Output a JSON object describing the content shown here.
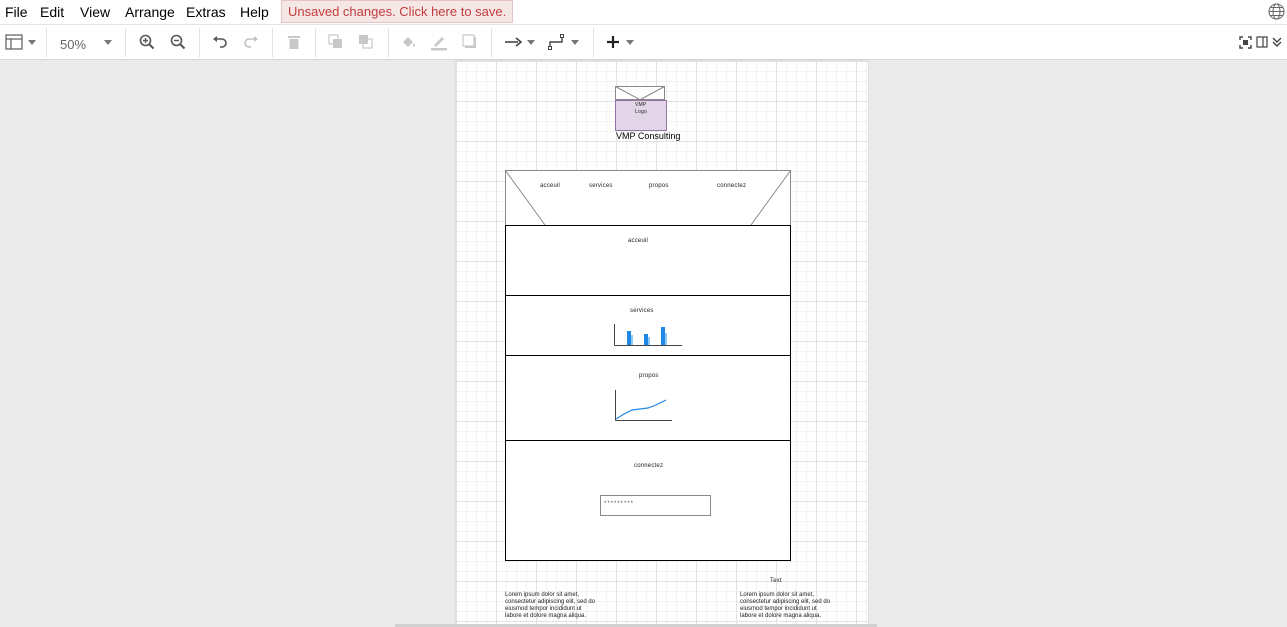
{
  "menubar": {
    "items": [
      "File",
      "Edit",
      "View",
      "Arrange",
      "Extras",
      "Help"
    ],
    "unsaved_notice": "Unsaved changes. Click here to save."
  },
  "toolbar": {
    "zoom": "50%"
  },
  "diagram": {
    "logo_label_line1": "VMP",
    "logo_label_line2": "Logo",
    "company_name": "VMP Consulting",
    "nav": [
      "acceuil",
      "services",
      "propos",
      "connectez"
    ],
    "sections": {
      "acceuil": "acceuil",
      "services": "services",
      "propos": "propos",
      "connectez": "connectez"
    },
    "password_field": "*********",
    "footer_heading": "Text",
    "lorem_left": "Lorem ipsum dolor sit amet, consectetur adipiscing elit, sed do eiusmod tempor incididunt ut labore et dolore magna aliqua.",
    "lorem_right": "Lorem ipsum dolor sit amet, consectetur adipiscing elit, sed do eiusmod tempor incididunt ut labore et dolore magna aliqua."
  },
  "colors": {
    "logo_fill": "#e1d5e7",
    "logo_stroke": "#9673a6",
    "chart_blue": "#1e88e5",
    "unsaved_text": "#c23c3c"
  }
}
